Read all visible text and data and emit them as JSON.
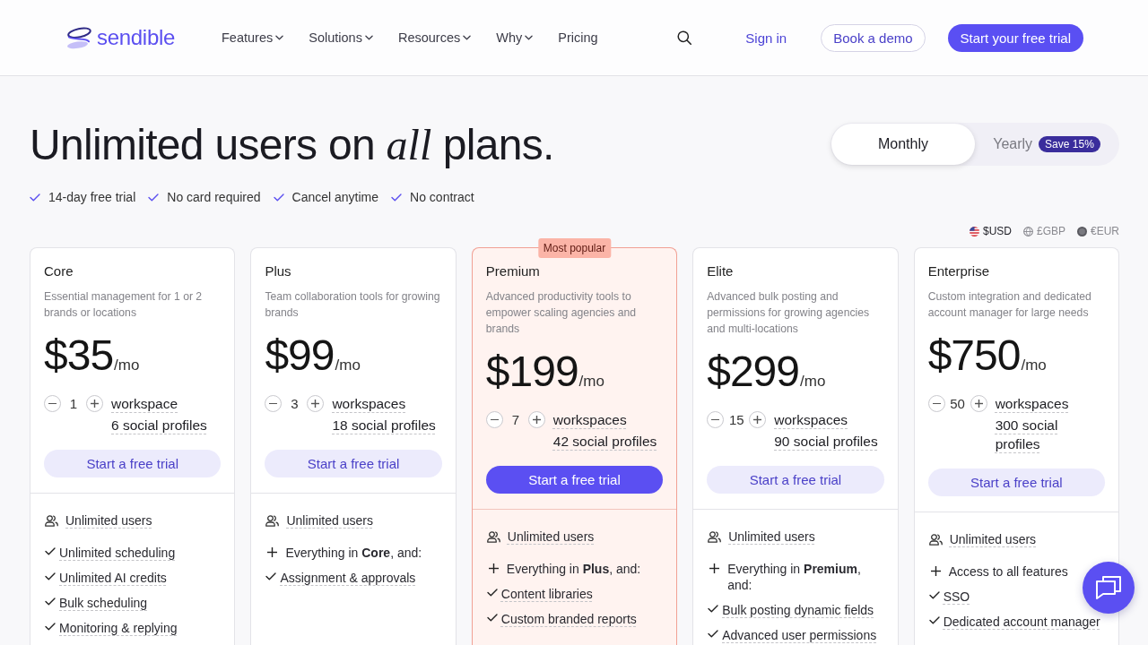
{
  "header": {
    "logo": {
      "text": "sendible"
    },
    "nav": [
      {
        "label": "Features",
        "has_menu": true
      },
      {
        "label": "Solutions",
        "has_menu": true
      },
      {
        "label": "Resources",
        "has_menu": true
      },
      {
        "label": "Why",
        "has_menu": true
      },
      {
        "label": "Pricing",
        "has_menu": false
      }
    ],
    "sign_in": "Sign in",
    "demo_button": "Book a demo",
    "trial_button": "Start your free trial"
  },
  "hero": {
    "title": "Unlimited users on *all* plans.",
    "perks": [
      "14-day free trial",
      "No card required",
      "Cancel anytime",
      "No contract"
    ]
  },
  "billing": {
    "options": [
      {
        "label": "Monthly",
        "selected": true
      },
      {
        "label": "Yearly",
        "selected": false,
        "badge": "Save 15%"
      }
    ]
  },
  "currencies": [
    {
      "label": "$USD",
      "kind": "flag",
      "selected": true
    },
    {
      "label": "£GBP",
      "kind": "globe",
      "selected": false
    },
    {
      "label": "€EUR",
      "kind": "coin",
      "selected": false
    }
  ],
  "plans": [
    {
      "name": "Core",
      "description": "Essential management for 1 or 2 brands or locations",
      "price": "$35",
      "period": "/mo",
      "workspaces": "1",
      "workspace_label": "workspace",
      "profiles": "6 social profiles",
      "cta": "Start a free trial",
      "highlighted": false,
      "features": [
        {
          "kind": "users",
          "text": "Unlimited users"
        },
        {
          "kind": "check",
          "text": "Unlimited scheduling"
        },
        {
          "kind": "check",
          "text": "Unlimited AI credits"
        },
        {
          "kind": "check",
          "text": "Bulk scheduling"
        },
        {
          "kind": "check",
          "text": "Monitoring & replying"
        }
      ]
    },
    {
      "name": "Plus",
      "description": "Team collaboration tools for growing brands",
      "price": "$99",
      "period": "/mo",
      "workspaces": "3",
      "workspace_label": "workspaces",
      "profiles": "18 social profiles",
      "cta": "Start a free trial",
      "highlighted": false,
      "features": [
        {
          "kind": "users",
          "text": "Unlimited users"
        },
        {
          "kind": "plus",
          "text": "Everything in **Core**, and:"
        },
        {
          "kind": "check",
          "text": "Assignment & approvals"
        }
      ]
    },
    {
      "name": "Premium",
      "description": "Advanced productivity tools to empower scaling agencies and brands",
      "price": "$199",
      "period": "/mo",
      "workspaces": "7",
      "workspace_label": "workspaces",
      "profiles": "42 social profiles",
      "cta": "Start a free trial",
      "highlighted": true,
      "badge": "Most popular",
      "features": [
        {
          "kind": "users",
          "text": "Unlimited users"
        },
        {
          "kind": "plus",
          "text": "Everything in **Plus**, and:"
        },
        {
          "kind": "check",
          "text": "Content libraries"
        },
        {
          "kind": "check",
          "text": "Custom branded reports"
        }
      ]
    },
    {
      "name": "Elite",
      "description": "Advanced bulk posting and permissions for growing agencies and multi-locations",
      "price": "$299",
      "period": "/mo",
      "workspaces": "15",
      "workspace_label": "workspaces",
      "profiles": "90 social profiles",
      "cta": "Start a free trial",
      "highlighted": false,
      "features": [
        {
          "kind": "users",
          "text": "Unlimited users"
        },
        {
          "kind": "plus",
          "text": "Everything in **Premium**, and:"
        },
        {
          "kind": "check",
          "text": "Bulk posting dynamic fields"
        },
        {
          "kind": "check",
          "text": "Advanced user permissions"
        }
      ]
    },
    {
      "name": "Enterprise",
      "description": "Custom integration and dedicated account manager for large needs",
      "price": "$750",
      "period": "/mo",
      "workspaces": "50",
      "workspace_label": "workspaces",
      "profiles": "300 social profiles",
      "cta": "Start a free trial",
      "highlighted": false,
      "features": [
        {
          "kind": "users",
          "text": "Unlimited users"
        },
        {
          "kind": "plus",
          "text": "Access to all features"
        },
        {
          "kind": "check",
          "text": "SSO"
        },
        {
          "kind": "check",
          "text": "Dedicated account manager"
        }
      ]
    }
  ]
}
